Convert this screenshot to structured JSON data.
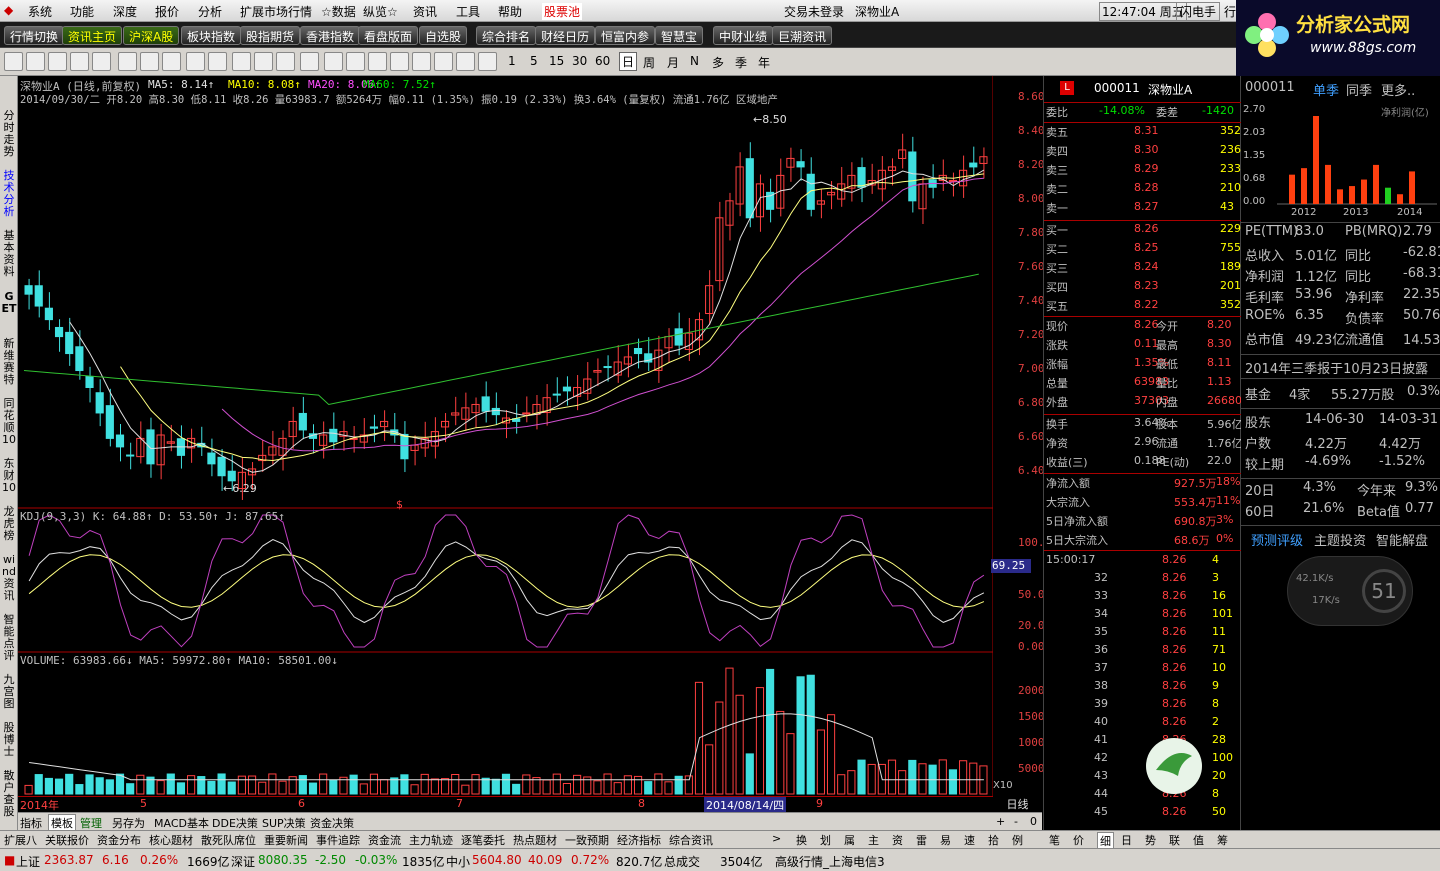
{
  "menu": {
    "items": [
      "系统",
      "功能",
      "深度",
      "报价",
      "分析",
      "扩展市场行情",
      "☆数据",
      "纵览☆",
      "资讯",
      "工具",
      "帮助",
      "股票池"
    ],
    "title_status": "交易未登录",
    "title_stock": "深物业A",
    "time": "12:47:04 周五",
    "flash_btn": "闪电手",
    "extra": "行"
  },
  "toolbar1": [
    "行情切换",
    "资讯主页",
    "沪深A股",
    "板块指数",
    "股指期货",
    "香港指数",
    "看盘版面",
    "自选股",
    "综合排名",
    "财经日历",
    "恒富内参",
    "智慧宝",
    "中财业绩",
    "巨潮资讯"
  ],
  "toolbar2_periods": [
    "1",
    "5",
    "15",
    "30",
    "60",
    "日",
    "周",
    "月",
    "N",
    "多",
    "季",
    "年"
  ],
  "logo": {
    "text": "分析家公式网",
    "url": "www.88gs.com"
  },
  "leftnav": [
    "分时走势",
    "技术分析",
    "基本资料",
    "GET",
    "新维赛特",
    "同花顺10",
    "东财10",
    "龙虎榜",
    "wind资讯",
    "智能点评",
    "九宫图",
    "股博士",
    "散户查股"
  ],
  "chart": {
    "title": "深物业A (日线,前复权)",
    "ma5": "MA5: 8.14↑",
    "ma10": "MA10: 8.08↑",
    "ma20": "MA20: 8.06↑",
    "ma60": "MA60: 7.52↑",
    "info2": "2014/09/30/二 开8.20 高8.30 低8.11 收8.26 量63983.7 额5264万 幅0.11 (1.35%) 振0.19 (2.33%) 换3.64% (量复权) 流通1.76亿 区域地产",
    "high_label": "8.50",
    "low_label": "6.29",
    "dollar": "$",
    "yticks": [
      "8.60",
      "8.40",
      "8.20",
      "8.00",
      "7.80",
      "7.60",
      "7.40",
      "7.20",
      "7.00",
      "6.80",
      "6.60",
      "6.40"
    ],
    "kdj_title": "KDJ(9,3,3) K: 64.88↑ D: 53.50↑ J: 87.65↑",
    "kdj_ticks": [
      "100.00",
      "50.00",
      "20.00",
      "0.00"
    ],
    "kdj_cur": "69.25",
    "vol_title": "VOLUME: 63983.66↓ MA5: 59972.80↑ MA10: 58501.00↓",
    "vol_ticks": [
      "20000",
      "15000",
      "10000",
      "5000"
    ],
    "vol_unit": "X10",
    "x_labels": [
      "2014年",
      "5",
      "6",
      "7",
      "8",
      "2014/08/14/四",
      "9"
    ],
    "period": "日线",
    "subtabs": [
      "指标",
      "模板",
      "管理",
      "另存为",
      "MACD基本",
      "DDE决策",
      "SUP决策",
      "资金决策"
    ]
  },
  "chart_data": {
    "type": "candlestick",
    "price_range": [
      6.29,
      8.5
    ],
    "closes": [
      7.45,
      7.38,
      7.3,
      7.2,
      7.1,
      7.0,
      6.9,
      6.75,
      6.6,
      6.55,
      6.5,
      6.6,
      6.45,
      6.62,
      6.58,
      6.5,
      6.6,
      6.55,
      6.45,
      6.38,
      6.35,
      6.4,
      6.42,
      6.5,
      6.55,
      6.6,
      6.7,
      6.65,
      6.6,
      6.62,
      6.58,
      6.64,
      6.6,
      6.62,
      6.66,
      6.7,
      6.62,
      6.48,
      6.56,
      6.6,
      6.64,
      6.7,
      6.75,
      6.78,
      6.8,
      6.76,
      6.74,
      6.72,
      6.7,
      6.75,
      6.8,
      6.84,
      6.86,
      6.88,
      6.9,
      6.95,
      7.0,
      7.02,
      7.05,
      7.08,
      7.1,
      7.05,
      7.12,
      7.2,
      7.15,
      7.22,
      7.3,
      7.5,
      7.9,
      8.0,
      8.2,
      7.9,
      8.1,
      7.95,
      8.15,
      8.25,
      8.2,
      7.95,
      8.0,
      8.05,
      8.1,
      8.15,
      8.08,
      8.12,
      8.18,
      8.2,
      8.3,
      8.0,
      8.1,
      8.08,
      8.15,
      8.12,
      8.18,
      8.2,
      8.26
    ]
  },
  "quote": {
    "code": "000011",
    "name": "深物业A",
    "weibi": "委比",
    "weibi_val": "-14.08%",
    "weicha": "委差",
    "weicha_val": "-1420",
    "asks": [
      [
        "卖五",
        "8.31",
        "352"
      ],
      [
        "卖四",
        "8.30",
        "2365"
      ],
      [
        "卖三",
        "8.29",
        "233"
      ],
      [
        "卖二",
        "8.28",
        "210"
      ],
      [
        "卖一",
        "8.27",
        "43"
      ]
    ],
    "bids": [
      [
        "买一",
        "8.26",
        "229"
      ],
      [
        "买二",
        "8.25",
        "755"
      ],
      [
        "买三",
        "8.24",
        "189"
      ],
      [
        "买四",
        "8.23",
        "201"
      ],
      [
        "买五",
        "8.22",
        "352"
      ]
    ],
    "stats": [
      [
        "现价",
        "8.26",
        "今开",
        "8.20"
      ],
      [
        "涨跌",
        "0.11",
        "最高",
        "8.30"
      ],
      [
        "涨幅",
        "1.35%",
        "最低",
        "8.11"
      ],
      [
        "总量",
        "63983",
        "量比",
        "1.13"
      ],
      [
        "外盘",
        "37303",
        "内盘",
        "26680"
      ]
    ],
    "stats2": [
      [
        "换手",
        "3.64%",
        "股本",
        "5.96亿"
      ],
      [
        "净资",
        "2.96",
        "流通",
        "1.76亿"
      ],
      [
        "收益(三)",
        "0.188",
        "PE(动)",
        "22.0"
      ]
    ],
    "flows": [
      [
        "净流入额",
        "927.5万",
        "18%"
      ],
      [
        "大宗流入",
        "553.4万",
        "11%"
      ],
      [
        "5日净流入额",
        "690.8万",
        "3%"
      ],
      [
        "5日大宗流入",
        "68.6万",
        "0%"
      ]
    ],
    "ticks_time": "15:00:17",
    "ticks": [
      [
        "",
        "8.26",
        "4"
      ],
      [
        "32",
        "8.26",
        "3"
      ],
      [
        "33",
        "8.26",
        "16"
      ],
      [
        "34",
        "8.26",
        "101"
      ],
      [
        "35",
        "8.26",
        "11"
      ],
      [
        "36",
        "8.26",
        "71"
      ],
      [
        "37",
        "8.26",
        "10"
      ],
      [
        "38",
        "8.26",
        "9"
      ],
      [
        "39",
        "8.26",
        "8"
      ],
      [
        "40",
        "8.26",
        "2"
      ],
      [
        "41",
        "8.26",
        "28"
      ],
      [
        "42",
        "8.26",
        "100"
      ],
      [
        "43",
        "8.26",
        "20"
      ],
      [
        "44",
        "8.26",
        "8"
      ],
      [
        "45",
        "8.26",
        "50"
      ]
    ]
  },
  "finance": {
    "code": "000011",
    "tabs": [
      "单季",
      "同季",
      "更多.."
    ],
    "chart_label": "净利润(亿)",
    "y": [
      "2.70",
      "2.03",
      "1.35",
      "0.68",
      "0.00"
    ],
    "years": [
      "2012",
      "2013",
      "2014"
    ],
    "bars": [
      0.9,
      1.1,
      2.7,
      1.2,
      0.45,
      0.55,
      0.75,
      1.2,
      0.5,
      0.3,
      1.0
    ],
    "rows": [
      [
        "PE(TTM)",
        "83.0",
        "PB(MRQ)",
        "2.79"
      ],
      [
        "总收入",
        "5.01亿",
        "同比",
        "-62.81"
      ],
      [
        "净利润",
        "1.12亿",
        "同比",
        "-68.31"
      ],
      [
        "毛利率",
        "53.96",
        "净利率",
        "22.35"
      ],
      [
        "ROE%",
        "6.35",
        "负债率",
        "50.76"
      ],
      [
        "总市值",
        "49.23亿",
        "流通值",
        "14.53亿"
      ]
    ],
    "report": "2014年三季报于10月23日披露",
    "fund": [
      "基金",
      "4家",
      "55.27万股",
      "0.3%"
    ],
    "holder": [
      [
        "股东",
        "14-06-30",
        "14-03-31"
      ],
      [
        "户数",
        "4.22万",
        "4.42万"
      ],
      [
        "较上期",
        "-4.69%",
        "-1.52%"
      ]
    ],
    "perf": [
      [
        "20日",
        "4.3%",
        "今年来",
        "9.3%"
      ],
      [
        "60日",
        "21.6%",
        "Beta值",
        "0.77"
      ]
    ],
    "links": [
      "预测评级",
      "主题投资",
      "智能解盘"
    ],
    "speed_up": "42.1K/s",
    "speed_down": "17K/s",
    "percent": "51"
  },
  "bottomtabs": [
    "扩展八",
    "关联报价",
    "资金分布",
    "核心题材",
    "散死队席位",
    "重要新闻",
    "事件追踪",
    "资金流",
    "主力轨迹",
    "逐笔委托",
    "热点题材",
    "一致预期",
    "经济指标",
    "综合资讯"
  ],
  "bottomtabs_right": [
    ">",
    "换",
    "划",
    "属",
    "主",
    "资",
    "雷",
    "易",
    "速",
    "拾",
    "例"
  ],
  "bottomtabs2": [
    "笔",
    "价",
    "细",
    "日",
    "势",
    "联",
    "值",
    "筹"
  ],
  "status": {
    "sh_label": "上证",
    "sh": "2363.87",
    "sh_chg": "6.16",
    "sh_pct": "0.26%",
    "sh_amt": "1669亿",
    "sz_label": "深证",
    "sz": "8080.35",
    "sz_chg": "-2.50",
    "sz_pct": "-0.03%",
    "sz_amt": "1835亿",
    "zx_label": "中小",
    "zx": "5604.80",
    "zx_chg": "40.09",
    "zx_pct": "0.72%",
    "zx_amt": "820.7亿",
    "deal_label": "总成交",
    "deal": "3504亿",
    "server": "高级行情_上海电信3"
  }
}
